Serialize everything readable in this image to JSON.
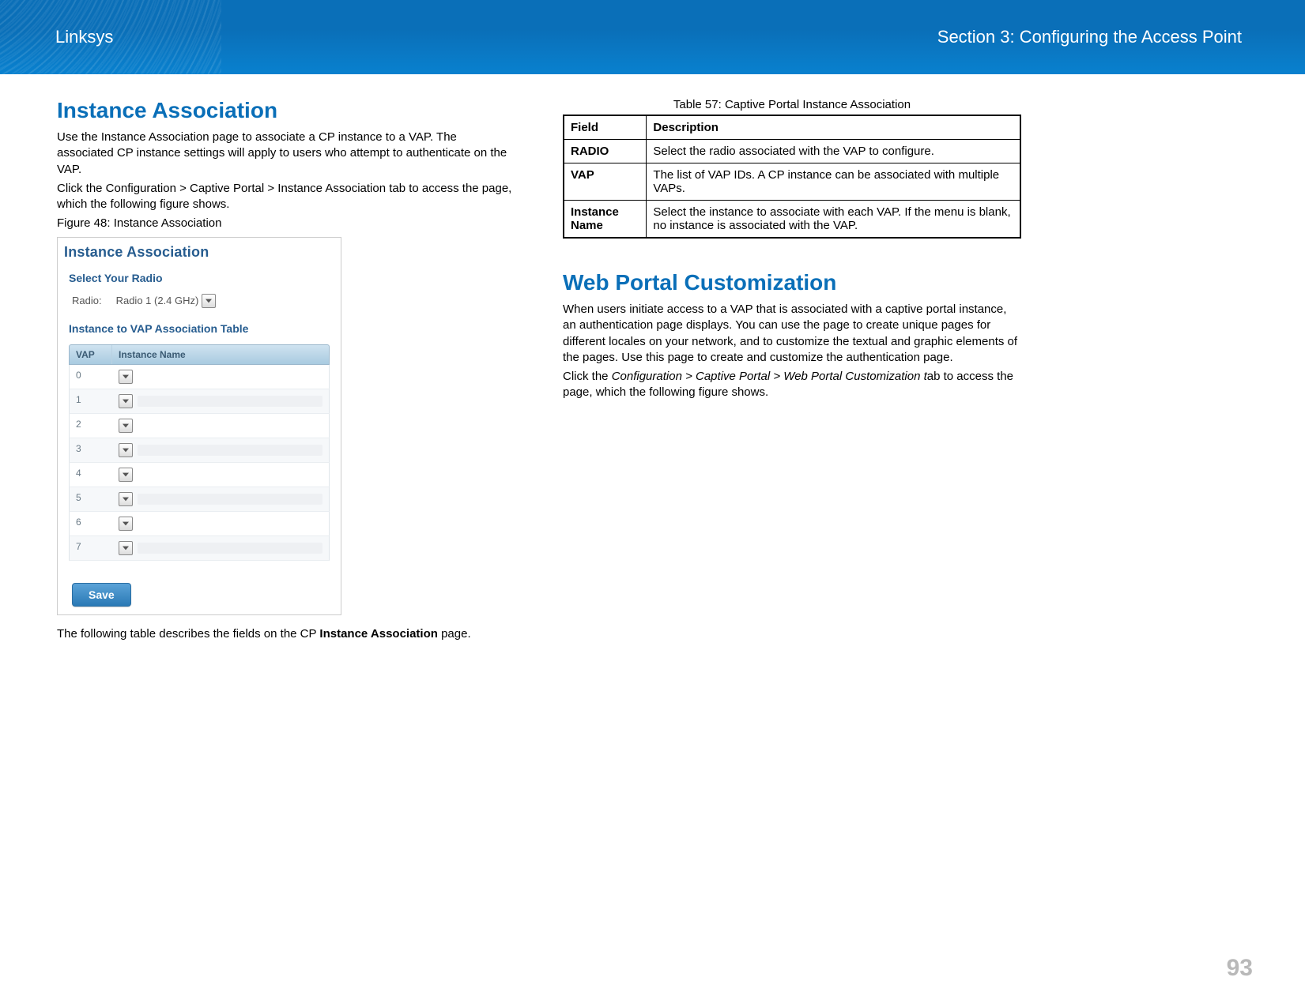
{
  "header": {
    "brand": "Linksys",
    "section": "Section 3:  Configuring the Access Point"
  },
  "page_number": "93",
  "left": {
    "heading": "Instance Association",
    "p1": "Use the Instance Association page to associate a CP instance to a VAP. The associated CP instance settings will apply to users who attempt to authenticate on the VAP.",
    "p2": "Click the Configuration > Captive Portal > Instance Association tab to access the page, which the following figure shows.",
    "fig_label": "Figure 48: Instance Association",
    "fig": {
      "title": "Instance Association",
      "section1": "Select Your Radio",
      "radio_label": "Radio:",
      "radio_value": "Radio 1 (2.4 GHz)",
      "section2": "Instance to VAP Association Table",
      "th_vap": "VAP",
      "th_iname": "Instance Name",
      "rows": [
        {
          "vap": "0"
        },
        {
          "vap": "1"
        },
        {
          "vap": "2"
        },
        {
          "vap": "3"
        },
        {
          "vap": "4"
        },
        {
          "vap": "5"
        },
        {
          "vap": "6"
        },
        {
          "vap": "7"
        }
      ],
      "save": "Save"
    },
    "after_fig_pre": "The following table describes the fields on the CP ",
    "after_fig_bold": "Instance Association",
    "after_fig_post": " page."
  },
  "right": {
    "table_caption": "Table 57: Captive Portal Instance Association",
    "th_field": "Field",
    "th_desc": "Description",
    "rows": [
      {
        "field": "RADIO",
        "desc": "Select the radio associated with the VAP to configure."
      },
      {
        "field": "VAP",
        "desc": "The list of VAP IDs. A CP instance can be associated with multiple VAPs."
      },
      {
        "field": "Instance Name",
        "desc": "Select the instance to associate with each VAP. If the menu is blank, no instance is associated with the VAP."
      }
    ],
    "heading2": "Web Portal Customization",
    "p3": "When users initiate access to a VAP that is associated with a captive portal instance, an authentication page displays. You can use the page to create unique pages for different locales on your network, and to customize the textual and graphic elements of the pages. Use this page to create and customize the authentication page.",
    "p4_pre": "Click the ",
    "p4_italic": "Configuration > Captive Portal > Web Portal Customization t",
    "p4_post": "ab to access the page, which the following figure shows."
  }
}
